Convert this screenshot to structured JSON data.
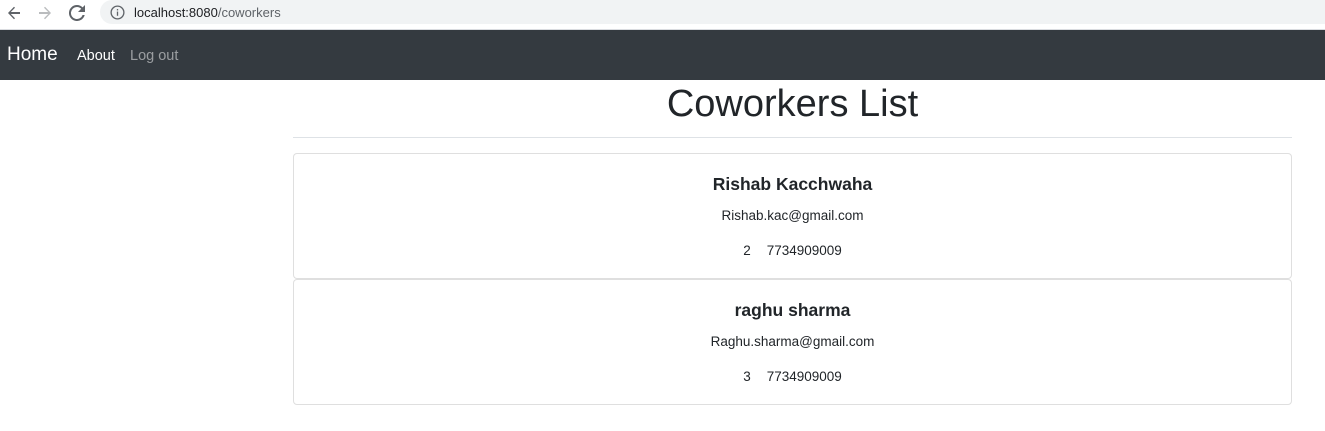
{
  "browser": {
    "url_host": "localhost:8080",
    "url_path": "/coworkers",
    "icons": {
      "back": "arrow-left-icon",
      "forward": "arrow-right-icon",
      "reload": "reload-icon",
      "info": "info-icon"
    }
  },
  "navbar": {
    "brand": "Home",
    "links": {
      "about": "About",
      "logout": "Log out"
    },
    "colors": {
      "background": "#343a40",
      "active_link": "#ffffff",
      "muted_link": "rgba(255,255,255,0.5)"
    }
  },
  "main": {
    "title": "Coworkers List",
    "coworkers": [
      {
        "name": "Rishab Kacchwaha",
        "email": "Rishab.kac@gmail.com",
        "id": "2",
        "phone": "7734909009"
      },
      {
        "name": "raghu sharma",
        "email": "Raghu.sharma@gmail.com",
        "id": "3",
        "phone": "7734909009"
      }
    ]
  }
}
